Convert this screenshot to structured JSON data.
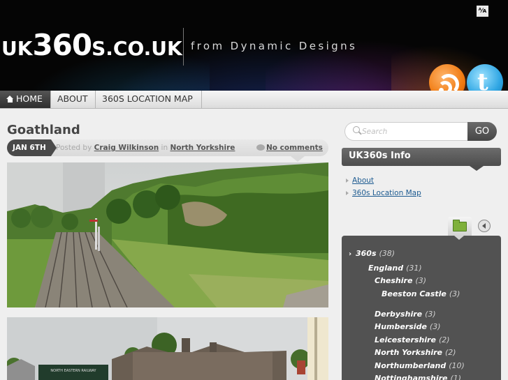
{
  "header": {
    "logo_prefix": "UK",
    "logo_main": "360",
    "logo_suffix": "s.co.uk",
    "tagline": "from Dynamic Designs",
    "font_toggle": "ᴬ⁄ᴀ"
  },
  "nav": {
    "items": [
      {
        "label": "HOME",
        "active": true
      },
      {
        "label": "ABOUT",
        "active": false
      },
      {
        "label": "360S LOCATION MAP",
        "active": false
      }
    ]
  },
  "post": {
    "title": "Goathland",
    "date": "JAN 6TH",
    "posted_by_label": "Posted by",
    "author": "Craig Wilkinson",
    "in_label": "in",
    "category": "North Yorkshire",
    "comments": "No comments"
  },
  "search": {
    "placeholder": "Search",
    "button": "GO"
  },
  "sidebar": {
    "widget_title": "UK360s Info",
    "links": [
      "About",
      "360s Location Map"
    ],
    "categories": [
      {
        "name": "360s",
        "count": "(38)"
      },
      {
        "name": "England",
        "count": "(31)"
      },
      {
        "name": "Cheshire",
        "count": "(3)"
      },
      {
        "name": "Beeston Castle",
        "count": "(3)"
      },
      {
        "name": "Derbyshire",
        "count": "(3)"
      },
      {
        "name": "Humberside",
        "count": "(3)"
      },
      {
        "name": "Leicestershire",
        "count": "(2)"
      },
      {
        "name": "North Yorkshire",
        "count": "(2)"
      },
      {
        "name": "Northumberland",
        "count": "(10)"
      },
      {
        "name": "Nottinghamshire",
        "count": "(1)"
      }
    ]
  },
  "photo2_sign": "NORTH EASTERN RAILWAY"
}
